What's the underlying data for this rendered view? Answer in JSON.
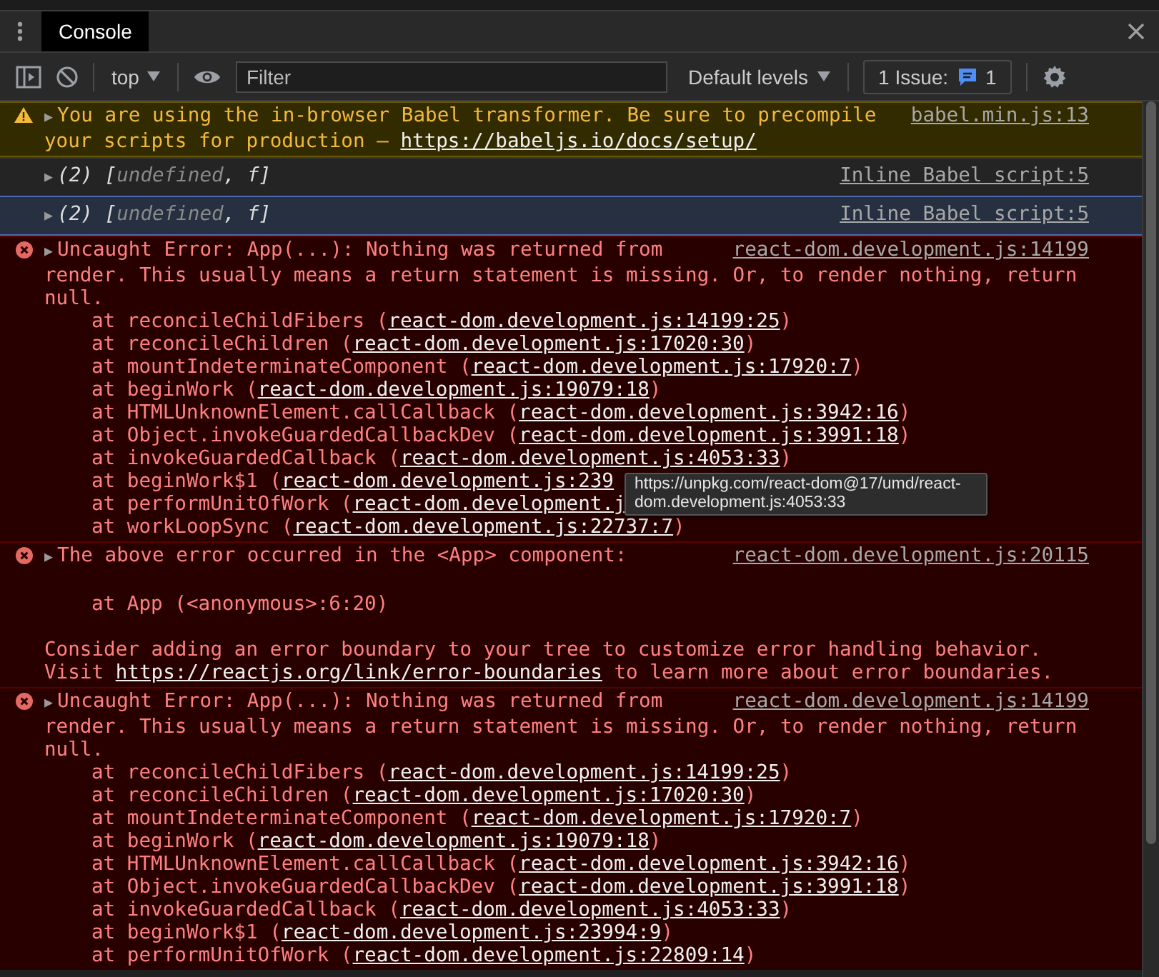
{
  "tabs": [
    {
      "label": "Console",
      "selected": true
    }
  ],
  "toolbar": {
    "context": "top",
    "filter": {
      "placeholder": "Filter"
    },
    "levels": "Default levels",
    "issues_label": "1 Issue:",
    "issues_count": "1"
  },
  "messages": [
    {
      "kind": "warning",
      "toggle": "▶",
      "source": "babel.min.js:13",
      "summary": [
        {
          "kind": "text",
          "text": "You are using the in-browser Babel transformer. Be sure to precompile"
        }
      ],
      "blocks": [
        {
          "kind": "text",
          "parts": [
            {
              "kind": "text",
              "text": "your scripts for production – "
            },
            {
              "kind": "link",
              "text": "https://babeljs.io/docs/setup/"
            }
          ]
        }
      ]
    },
    {
      "kind": "log",
      "selected": false,
      "toggle": "▶",
      "source": "Inline Babel script:5",
      "summary": [
        {
          "kind": "text",
          "text": "(2) ["
        },
        {
          "kind": "value",
          "text": "undefined"
        },
        {
          "kind": "text",
          "text": ", f]"
        }
      ]
    },
    {
      "kind": "log",
      "selected": true,
      "toggle": "▶",
      "source": "Inline Babel script:5",
      "summary": [
        {
          "kind": "text",
          "text": "(2) ["
        },
        {
          "kind": "value",
          "text": "undefined"
        },
        {
          "kind": "text",
          "text": ", f]"
        }
      ]
    },
    {
      "kind": "error",
      "toggle": "▶",
      "source": "react-dom.development.js:14199",
      "tooltip": "https://unpkg.com/react-dom@17/umd/react-dom.development.js:4053:33",
      "summary": [
        {
          "kind": "text",
          "text": "Uncaught Error: App(...): Nothing was returned from"
        }
      ],
      "blocks": [
        {
          "kind": "text",
          "parts": [
            {
              "kind": "text",
              "text": "render. This usually means a return statement is missing. Or, to render nothing, return null."
            }
          ]
        },
        {
          "kind": "frame",
          "parts": [
            {
              "kind": "text",
              "text": "at reconcileChildFibers ("
            },
            {
              "kind": "link",
              "text": "react-dom.development.js:14199:25"
            },
            {
              "kind": "text",
              "text": ")"
            }
          ]
        },
        {
          "kind": "frame",
          "parts": [
            {
              "kind": "text",
              "text": "at reconcileChildren ("
            },
            {
              "kind": "link",
              "text": "react-dom.development.js:17020:30"
            },
            {
              "kind": "text",
              "text": ")"
            }
          ]
        },
        {
          "kind": "frame",
          "parts": [
            {
              "kind": "text",
              "text": "at mountIndeterminateComponent ("
            },
            {
              "kind": "link",
              "text": "react-dom.development.js:17920:7"
            },
            {
              "kind": "text",
              "text": ")"
            }
          ]
        },
        {
          "kind": "frame",
          "parts": [
            {
              "kind": "text",
              "text": "at beginWork ("
            },
            {
              "kind": "link",
              "text": "react-dom.development.js:19079:18"
            },
            {
              "kind": "text",
              "text": ")"
            }
          ]
        },
        {
          "kind": "frame",
          "parts": [
            {
              "kind": "text",
              "text": "at HTMLUnknownElement.callCallback ("
            },
            {
              "kind": "link",
              "text": "react-dom.development.js:3942:16"
            },
            {
              "kind": "text",
              "text": ")"
            }
          ]
        },
        {
          "kind": "frame",
          "parts": [
            {
              "kind": "text",
              "text": "at Object.invokeGuardedCallbackDev ("
            },
            {
              "kind": "link",
              "text": "react-dom.development.js:3991:18"
            },
            {
              "kind": "text",
              "text": ")"
            }
          ]
        },
        {
          "kind": "frame",
          "parts": [
            {
              "kind": "text",
              "text": "at invokeGuardedCallback ("
            },
            {
              "kind": "link",
              "text": "react-dom.development.js:4053:33"
            },
            {
              "kind": "text",
              "text": ")"
            }
          ]
        },
        {
          "kind": "frame",
          "parts": [
            {
              "kind": "text",
              "text": "at beginWork$1 ("
            },
            {
              "kind": "link",
              "text": "react-dom.development.js:239"
            }
          ]
        },
        {
          "kind": "frame",
          "parts": [
            {
              "kind": "text",
              "text": "at performUnitOfWork ("
            },
            {
              "kind": "link",
              "text": "react-dom.development.j"
            }
          ]
        },
        {
          "kind": "frame",
          "parts": [
            {
              "kind": "text",
              "text": "at workLoopSync ("
            },
            {
              "kind": "link",
              "text": "react-dom.development.js:22737:7"
            },
            {
              "kind": "text",
              "text": ")"
            }
          ]
        }
      ]
    },
    {
      "kind": "error",
      "toggle": "▶",
      "source": "react-dom.development.js:20115",
      "summary": [
        {
          "kind": "text",
          "text": "The above error occurred in the <App> component:"
        }
      ],
      "blocks": [
        {
          "kind": "component-frame",
          "parts": [
            {
              "kind": "text",
              "text": "at App (<anonymous>:6:20)"
            }
          ]
        },
        {
          "kind": "hint",
          "parts": [
            {
              "kind": "text",
              "text": "Consider adding an error boundary to your tree to customize error handling behavior. Visit "
            },
            {
              "kind": "link",
              "text": "https://reactjs.org/link/error-boundaries"
            },
            {
              "kind": "text",
              "text": " to learn more about error boundaries."
            }
          ]
        }
      ]
    },
    {
      "kind": "error",
      "toggle": "▶",
      "source": "react-dom.development.js:14199",
      "summary": [
        {
          "kind": "text",
          "text": "Uncaught Error: App(...): Nothing was returned from"
        }
      ],
      "blocks": [
        {
          "kind": "text",
          "parts": [
            {
              "kind": "text",
              "text": "render. This usually means a return statement is missing. Or, to render nothing, return null."
            }
          ]
        },
        {
          "kind": "frame",
          "parts": [
            {
              "kind": "text",
              "text": "at reconcileChildFibers ("
            },
            {
              "kind": "link",
              "text": "react-dom.development.js:14199:25"
            },
            {
              "kind": "text",
              "text": ")"
            }
          ]
        },
        {
          "kind": "frame",
          "parts": [
            {
              "kind": "text",
              "text": "at reconcileChildren ("
            },
            {
              "kind": "link",
              "text": "react-dom.development.js:17020:30"
            },
            {
              "kind": "text",
              "text": ")"
            }
          ]
        },
        {
          "kind": "frame",
          "parts": [
            {
              "kind": "text",
              "text": "at mountIndeterminateComponent ("
            },
            {
              "kind": "link",
              "text": "react-dom.development.js:17920:7"
            },
            {
              "kind": "text",
              "text": ")"
            }
          ]
        },
        {
          "kind": "frame",
          "parts": [
            {
              "kind": "text",
              "text": "at beginWork ("
            },
            {
              "kind": "link",
              "text": "react-dom.development.js:19079:18"
            },
            {
              "kind": "text",
              "text": ")"
            }
          ]
        },
        {
          "kind": "frame",
          "parts": [
            {
              "kind": "text",
              "text": "at HTMLUnknownElement.callCallback ("
            },
            {
              "kind": "link",
              "text": "react-dom.development.js:3942:16"
            },
            {
              "kind": "text",
              "text": ")"
            }
          ]
        },
        {
          "kind": "frame",
          "parts": [
            {
              "kind": "text",
              "text": "at Object.invokeGuardedCallbackDev ("
            },
            {
              "kind": "link",
              "text": "react-dom.development.js:3991:18"
            },
            {
              "kind": "text",
              "text": ")"
            }
          ]
        },
        {
          "kind": "frame",
          "parts": [
            {
              "kind": "text",
              "text": "at invokeGuardedCallback ("
            },
            {
              "kind": "link",
              "text": "react-dom.development.js:4053:33"
            },
            {
              "kind": "text",
              "text": ")"
            }
          ]
        },
        {
          "kind": "frame",
          "parts": [
            {
              "kind": "text",
              "text": "at beginWork$1 ("
            },
            {
              "kind": "link",
              "text": "react-dom.development.js:23994:9"
            },
            {
              "kind": "text",
              "text": ")"
            }
          ]
        },
        {
          "kind": "frame",
          "parts": [
            {
              "kind": "text",
              "text": "at performUnitOfWork ("
            },
            {
              "kind": "link",
              "text": "react-dom.development.js:22809:14"
            },
            {
              "kind": "text",
              "text": ")"
            }
          ]
        }
      ]
    }
  ]
}
